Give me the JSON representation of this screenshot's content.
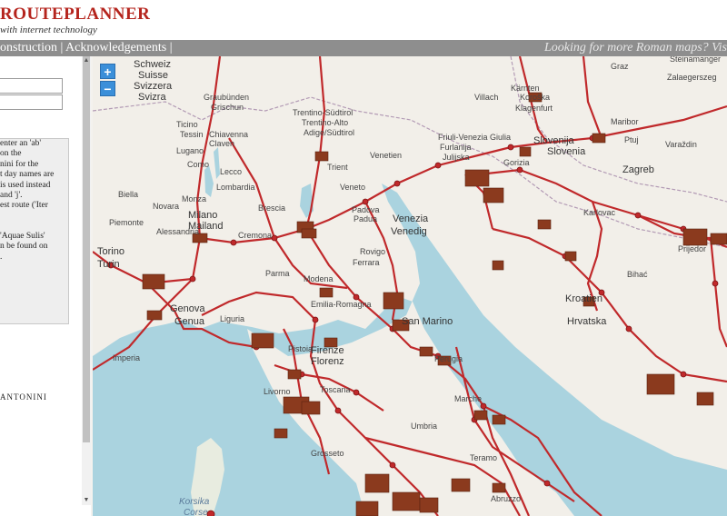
{
  "header": {
    "title": "ROUTEPLANNER",
    "subtitle": "with internet technology"
  },
  "nav": {
    "links": [
      "onstruction",
      "Acknowledgements"
    ],
    "separator": " | ",
    "promo": "Looking for more Roman maps? Vis"
  },
  "sidebar": {
    "field_from_value": "",
    "field_to_value": "",
    "info_lines": [
      "enter an 'ab'",
      "on the",
      "nini for the",
      "t day names are",
      "is used instead",
      "and 'j'.",
      "est route ('Iter",
      "",
      "'Aquae Sulis'",
      "n be found on",
      "."
    ],
    "credit": "ANTONINI"
  },
  "map": {
    "zoom_in_label": "+",
    "zoom_out_label": "−",
    "colors": {
      "road": "#c0292b",
      "water": "#aad3df",
      "land": "#f2efe9",
      "station": "#8b3a1e"
    },
    "place_labels": [
      "Schweiz",
      "Suisse",
      "Svizzera",
      "Svizra",
      "Graubünden",
      "Grischun",
      "Ticino",
      "Tessin",
      "Lugano",
      "Chiavenna",
      "Claven",
      "Como",
      "Lecco",
      "Lombardia",
      "Biella",
      "Novara",
      "Monza",
      "Milano",
      "Brescia",
      "Mailand",
      "Cremona",
      "Piemonte",
      "Alessandria",
      "Torino",
      "Turin",
      "Liguria",
      "Genova",
      "Genua",
      "Imperia",
      "Trentino-Südtirol",
      "Trentino-Alto",
      "Adige/Südtirol",
      "Trient",
      "Veneto",
      "Venetien",
      "Padova",
      "Padua",
      "Venezia",
      "Venedig",
      "Rovigo",
      "Ferrara",
      "Parma",
      "Modena",
      "Emilia-Romagna",
      "Friuli-Venezia Giulia",
      "Furlanija",
      "Julijska",
      "Gorizia",
      "Kärnten",
      "Koroška",
      "Klagenfurt",
      "Villach",
      "Graz",
      "Maribor",
      "Ptuj",
      "Slovenija",
      "Slovenia",
      "Zagreb",
      "Varaždin",
      "Karlovac",
      "Hrvatska",
      "Kroatien",
      "Bihać",
      "Prijedor",
      "Steinamanger",
      "Zalaegerszeg",
      "San Marino",
      "Firenze",
      "Florenz",
      "Pistoia",
      "Livorno",
      "Toscana",
      "Grosseto",
      "Perugia",
      "Umbria",
      "Marche",
      "Teramo",
      "Abruzzo",
      "Korsika",
      "Corse"
    ]
  }
}
